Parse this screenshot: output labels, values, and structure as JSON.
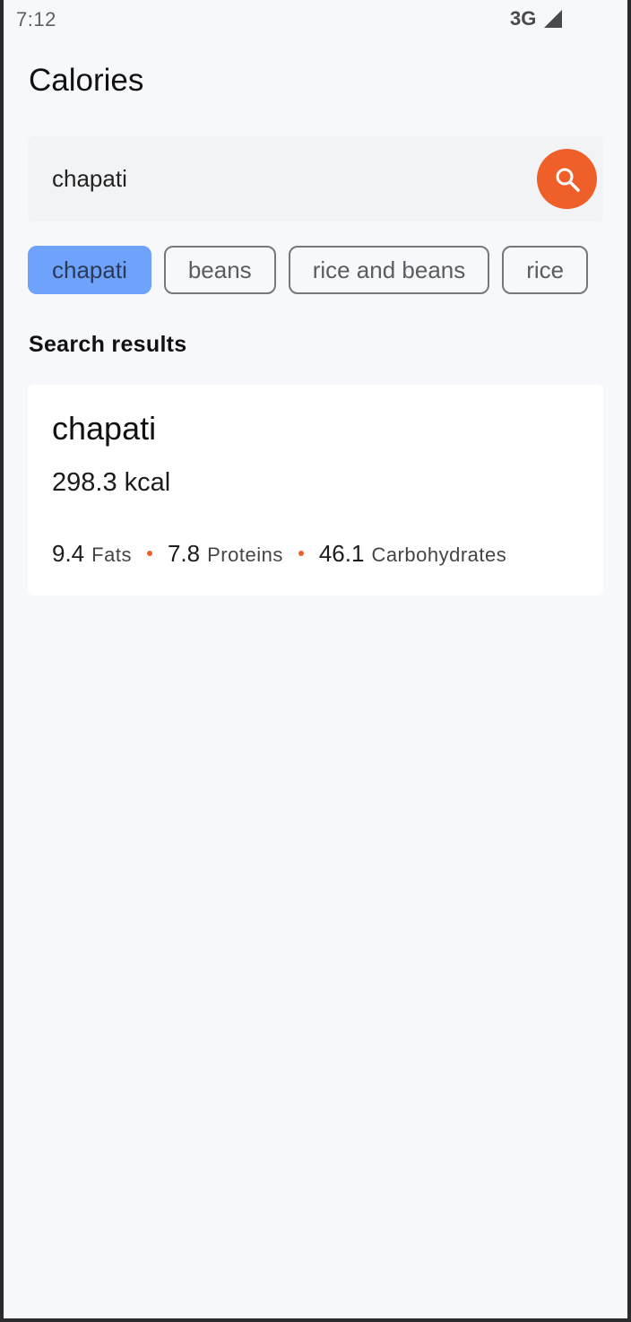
{
  "status_bar": {
    "time": "7:12",
    "network": "3G",
    "signal_icon": "cellular-signal-icon"
  },
  "header": {
    "title": "Calories"
  },
  "search": {
    "value": "chapati",
    "button_icon": "search-icon",
    "button_color": "#ef5f2a"
  },
  "chips": [
    {
      "label": "chapati",
      "selected": true
    },
    {
      "label": "beans",
      "selected": false
    },
    {
      "label": "rice and beans",
      "selected": false
    },
    {
      "label": "rice",
      "selected": false
    }
  ],
  "results": {
    "heading": "Search results",
    "items": [
      {
        "name": "chapati",
        "kcal": "298.3 kcal",
        "fats_value": "9.4",
        "fats_label": "Fats",
        "proteins_value": "7.8",
        "proteins_label": "Proteins",
        "carbs_value": "46.1",
        "carbs_label": "Carbohydrates"
      }
    ]
  },
  "colors": {
    "accent": "#ef5f2a",
    "chip_selected": "#6ea2fb",
    "background": "#f7f8fc"
  }
}
